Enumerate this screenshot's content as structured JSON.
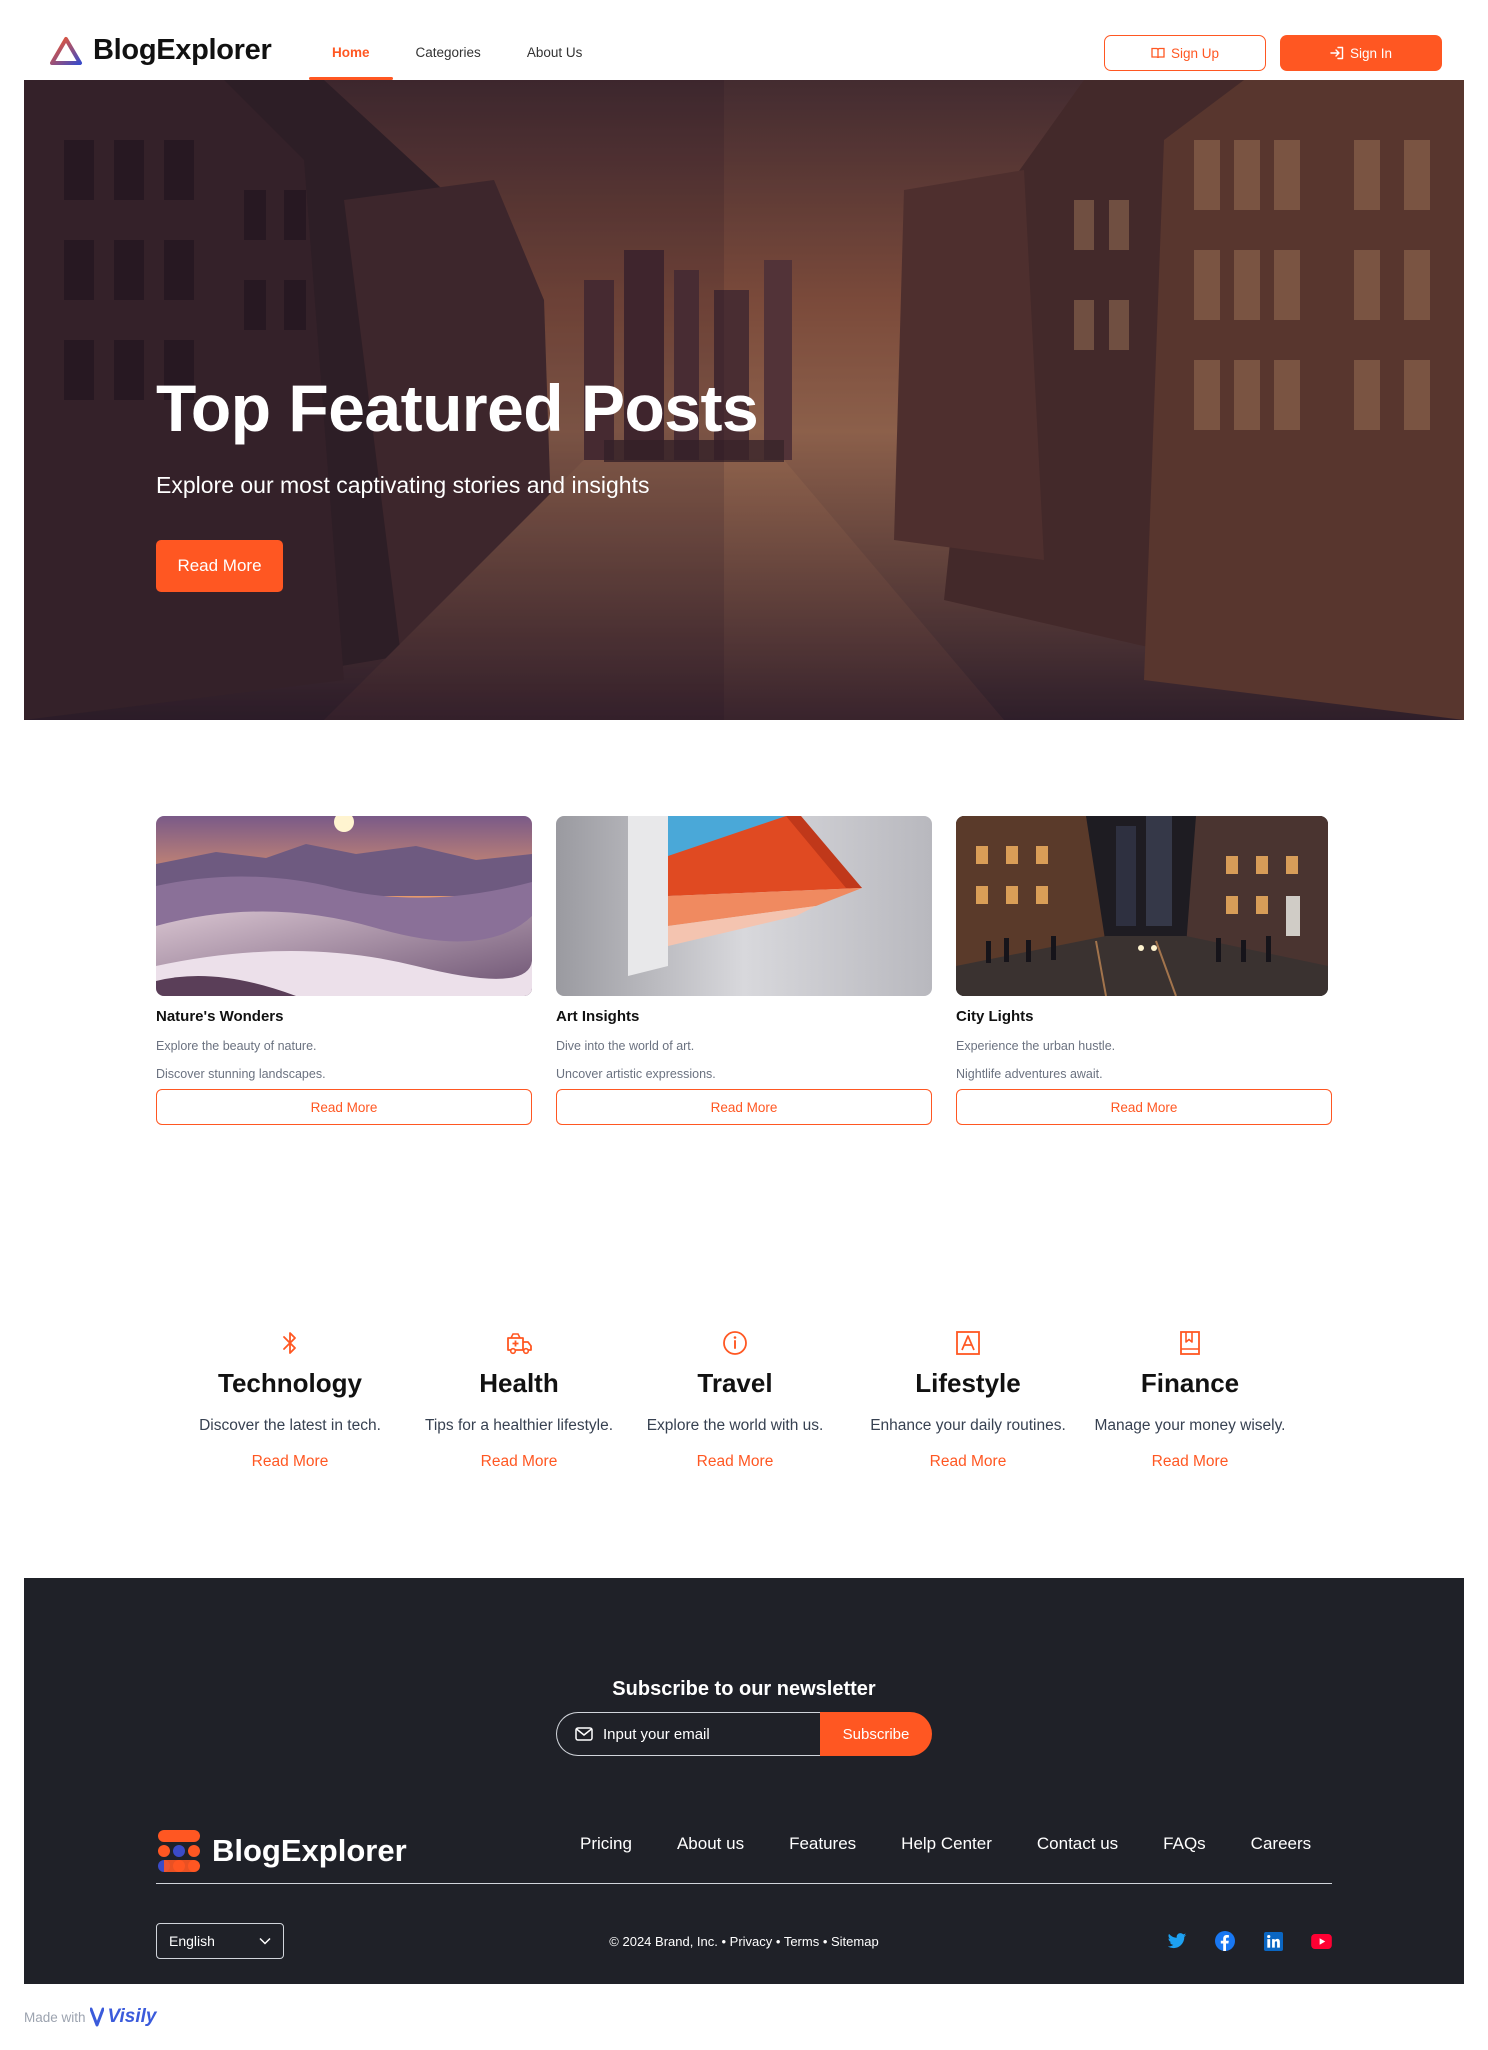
{
  "header": {
    "brand": "BlogExplorer",
    "nav": [
      {
        "label": "Home",
        "active": true
      },
      {
        "label": "Categories",
        "active": false
      },
      {
        "label": "About Us",
        "active": false
      }
    ],
    "signup_label": "Sign Up",
    "signin_label": "Sign In"
  },
  "hero": {
    "title": "Top Featured Posts",
    "subtitle": "Explore our most captivating stories and insights",
    "button": "Read More"
  },
  "cards": [
    {
      "title": "Nature's Wonders",
      "line1": "Explore the beauty of nature.",
      "line2": "Discover stunning landscapes.",
      "button": "Read More"
    },
    {
      "title": "Art Insights",
      "line1": "Dive into the world of art.",
      "line2": "Uncover artistic expressions.",
      "button": "Read More"
    },
    {
      "title": "City Lights",
      "line1": "Experience the urban hustle.",
      "line2": "Nightlife adventures await.",
      "button": "Read More"
    }
  ],
  "categories": [
    {
      "icon": "bluetooth-icon",
      "title": "Technology",
      "desc": "Discover the latest in tech.",
      "link": "Read More"
    },
    {
      "icon": "ambulance-icon",
      "title": "Health",
      "desc": "Tips for a healthier lifestyle.",
      "link": "Read More"
    },
    {
      "icon": "info-icon",
      "title": "Travel",
      "desc": "Explore the world with us.",
      "link": "Read More"
    },
    {
      "icon": "font-icon",
      "title": "Lifestyle",
      "desc": "Enhance your daily routines.",
      "link": "Read More"
    },
    {
      "icon": "bookmark-book-icon",
      "title": "Finance",
      "desc": "Manage your money wisely.",
      "link": "Read More"
    }
  ],
  "footer": {
    "newsletter_title": "Subscribe to our newsletter",
    "email_placeholder": "Input your email",
    "subscribe_label": "Subscribe",
    "brand": "BlogExplorer",
    "links": [
      "Pricing",
      "About us",
      "Features",
      "Help Center",
      "Contact us",
      "FAQs",
      "Careers"
    ],
    "language": "English",
    "copyright": "© 2024 Brand, Inc. • Privacy • Terms • Sitemap",
    "social": [
      "twitter-icon",
      "facebook-icon",
      "linkedin-icon",
      "youtube-icon"
    ]
  },
  "made_with": {
    "label": "Made with",
    "brand": "Visily"
  },
  "colors": {
    "accent": "#ff5722",
    "footer_bg": "#1f2128"
  }
}
